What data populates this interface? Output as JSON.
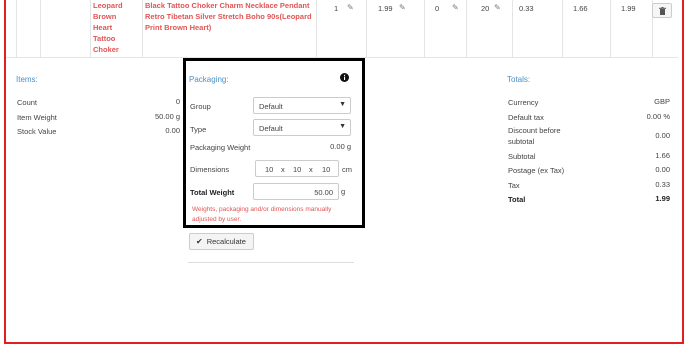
{
  "row": {
    "product_name": [
      "Leopard",
      "Brown",
      "Heart",
      "Tattoo",
      "Choker"
    ],
    "description": [
      "Black Tattoo Choker Charm Necklace Pendant",
      "Retro Tibetan Silver Stretch Boho 90s(Leopard",
      "Print Brown Heart)"
    ],
    "qty": "1",
    "price": "1.99",
    "discount": "0",
    "tax_rate": "20",
    "tax": "0.33",
    "net": "1.66",
    "total": "1.99"
  },
  "items": {
    "title": "Items:",
    "rows": [
      {
        "label": "Count",
        "value": "0"
      },
      {
        "label": "Item Weight",
        "value": "50.00 g"
      },
      {
        "label": "Stock Value",
        "value": "0.00"
      }
    ]
  },
  "packaging": {
    "title": "Packaging:",
    "group_label": "Group",
    "group_value": "Default",
    "type_label": "Type",
    "type_value": "Default",
    "weight_label": "Packaging Weight",
    "weight_value": "0.00 g",
    "dimensions_label": "Dimensions",
    "dim_l": "10",
    "dim_w": "10",
    "dim_h": "10",
    "dim_sep": "x",
    "dim_unit": "cm",
    "total_weight_label": "Total Weight",
    "total_weight_value": "50.00",
    "total_weight_unit": "g",
    "warning": "Weights, packaging and/or dimensions manually adjusted by user.",
    "recalc_label": "Recalculate"
  },
  "totals": {
    "title": "Totals:",
    "rows": [
      {
        "label": "Currency",
        "value": "GBP"
      },
      {
        "label": "Default tax",
        "value": "0.00 %"
      },
      {
        "label": "Discount before subtotal",
        "value": "0.00"
      },
      {
        "label": "Subtotal",
        "value": "1.66"
      },
      {
        "label": "Postage (ex Tax)",
        "value": "0.00"
      },
      {
        "label": "Tax",
        "value": "0.33"
      },
      {
        "label": "Total",
        "value": "1.99"
      }
    ]
  },
  "colors": {
    "frame": "#e02020",
    "link": "#e05555",
    "section_title": "#4a90c8"
  }
}
